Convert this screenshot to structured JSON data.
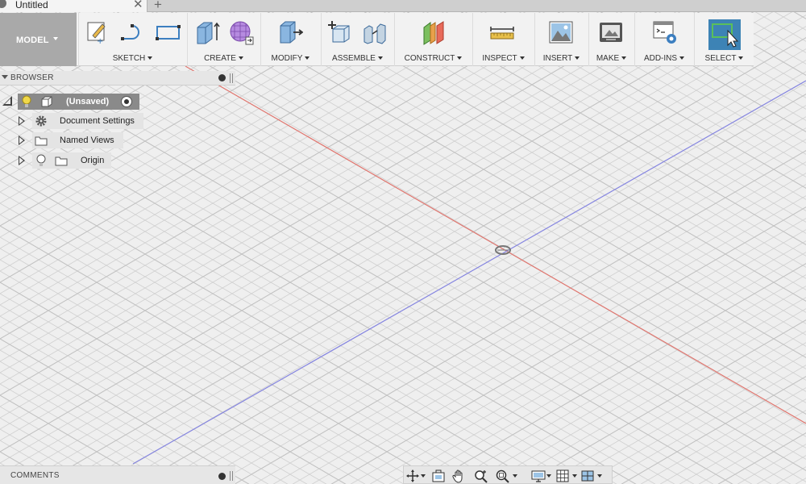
{
  "tab": {
    "title": "Untitled",
    "close_glyph": "✕",
    "new_glyph": "+"
  },
  "workspace": {
    "label": "MODEL"
  },
  "toolbar": {
    "groups": [
      {
        "label": "SKETCH"
      },
      {
        "label": "CREATE"
      },
      {
        "label": "MODIFY"
      },
      {
        "label": "ASSEMBLE"
      },
      {
        "label": "CONSTRUCT"
      },
      {
        "label": "INSPECT"
      },
      {
        "label": "INSERT"
      },
      {
        "label": "MAKE"
      },
      {
        "label": "ADD-INS"
      },
      {
        "label": "SELECT"
      }
    ]
  },
  "browser": {
    "title": "BROWSER",
    "root": {
      "label": "(Unsaved)"
    },
    "items": [
      {
        "label": "Document Settings",
        "icon": "gear-icon"
      },
      {
        "label": "Named Views",
        "icon": "folder-icon"
      },
      {
        "label": "Origin",
        "icon": "folder-icon"
      }
    ]
  },
  "comments": {
    "title": "COMMENTS"
  },
  "colors": {
    "x_axis": "#e0766f",
    "y_axis": "#8080e0",
    "grid": "#cfcfcf",
    "select_blue": "#3d83b5",
    "workspace_gray": "#a9a9a9"
  }
}
